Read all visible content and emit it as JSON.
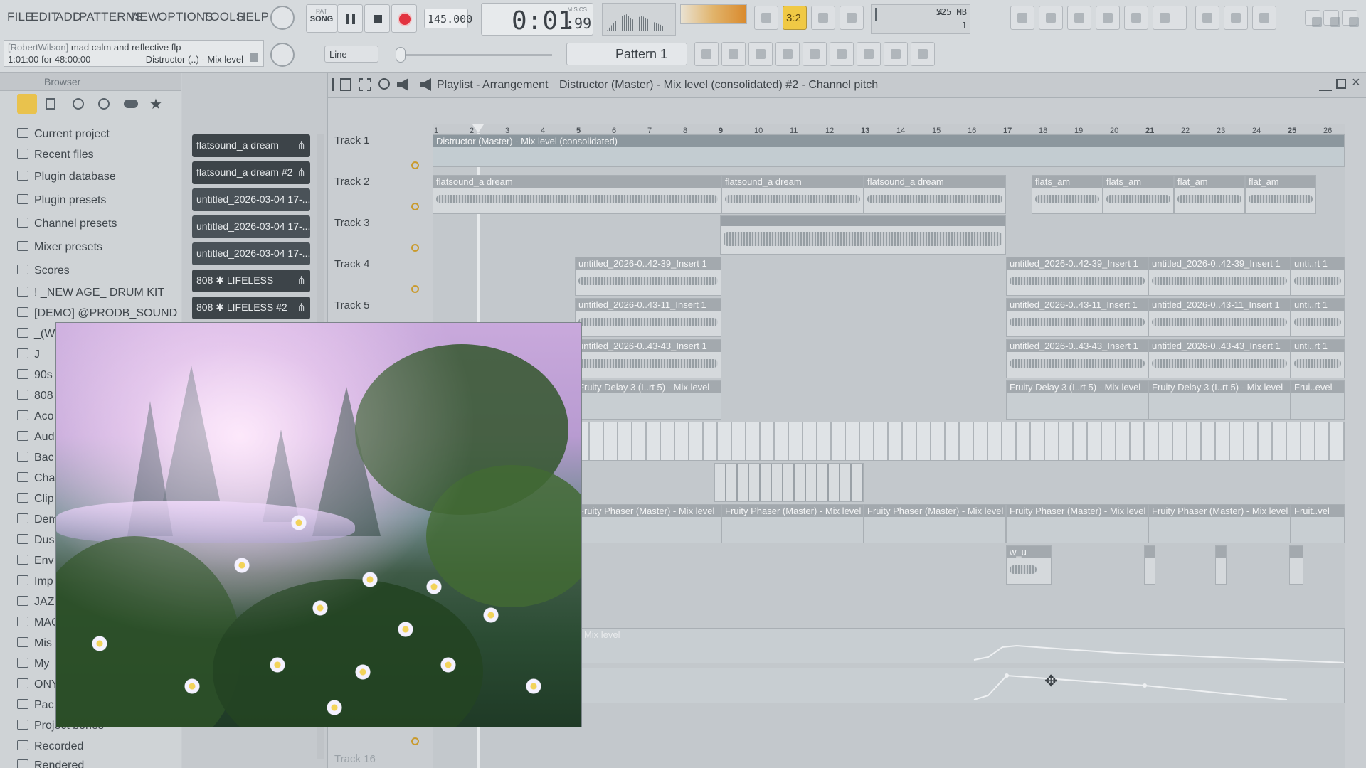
{
  "menu": [
    "FILE",
    "EDIT",
    "ADD",
    "PATTERNS",
    "VIEW",
    "OPTIONS",
    "TOOLS",
    "HELP"
  ],
  "transport": {
    "pat_label": "PAT",
    "song_label": "SONG",
    "tempo": "145.000",
    "time": "0:01",
    "time_sub": ":99",
    "time_unit": "M:S:CS",
    "memory": "525 MB",
    "cpu_top": "4",
    "cpu_bottom": "1"
  },
  "hint_bar": {
    "user": "[RobertWilson]",
    "project": "mad calm and reflective flp",
    "position": "1:01:00 for 48:00:00",
    "target": "Distructor (..) - Mix level"
  },
  "snap": {
    "label": "Line"
  },
  "pattern": {
    "label": "Pattern 1"
  },
  "playlist_title": "Playlist - Arrangement",
  "playlist_breadcrumb": "Distructor (Master) - Mix level (consolidated) #2 - Channel pitch",
  "browser": {
    "title": "Browser",
    "items": [
      "Current project",
      "Recent files",
      "Plugin database",
      "Plugin presets",
      "Channel presets",
      "Mixer presets",
      "Scores",
      "! _NEW AGE_ DRUM KIT",
      "[DEMO] @PRODB_SOUND KIT",
      "_(W",
      "J",
      "90s",
      "808",
      "Aco",
      "Aud",
      "Bac",
      "Cha",
      "Clip",
      "Dem",
      "Dus",
      "Env",
      "Imp",
      "JAZZ",
      "MAC",
      "Mis",
      "My",
      "ONY",
      "Pac",
      "Project bones",
      "Recorded",
      "Rendered"
    ]
  },
  "channels": [
    "flatsound_a dream",
    "flatsound_a dream #2",
    "untitled_2026-03-04 17-...",
    "untitled_2026-03-04 17-...",
    "untitled_2026-03-04 17-...",
    "808 ✱ LIFELESS",
    "808 ✱ LIFELESS #2"
  ],
  "tracks": [
    "Track 1",
    "Track 2",
    "Track 3",
    "Track 4",
    "Track 5",
    "Track 16"
  ],
  "ruler": [
    "1",
    "2",
    "3",
    "4",
    "5",
    "6",
    "7",
    "8",
    "9",
    "10",
    "11",
    "12",
    "13",
    "14",
    "15",
    "16",
    "17",
    "18",
    "19",
    "20",
    "21",
    "22",
    "23",
    "24",
    "25",
    "26"
  ],
  "clips": {
    "automation_master": "Distructor (Master) - Mix level (consolidated)",
    "flatsound": "flatsound_a dream",
    "flats_am": "flats_am",
    "flat_am": "flat_am",
    "ins1": "untitled_2026-0..42-39_Insert 1",
    "ins2": "untitled_2026-0..43-11_Insert 1",
    "ins3": "untitled_2026-0..43-43_Insert 1",
    "unti": "unti..rt 1",
    "delay": "Fruity Delay 3 (I..rt 5) - Mix level",
    "delay_short": "Frui..evel",
    "phaser": "Fruity Phaser (Master) - Mix level",
    "phaser_short": "Fruit..vel",
    "w_u": "w_u",
    "mix_level": "- Mix level"
  }
}
